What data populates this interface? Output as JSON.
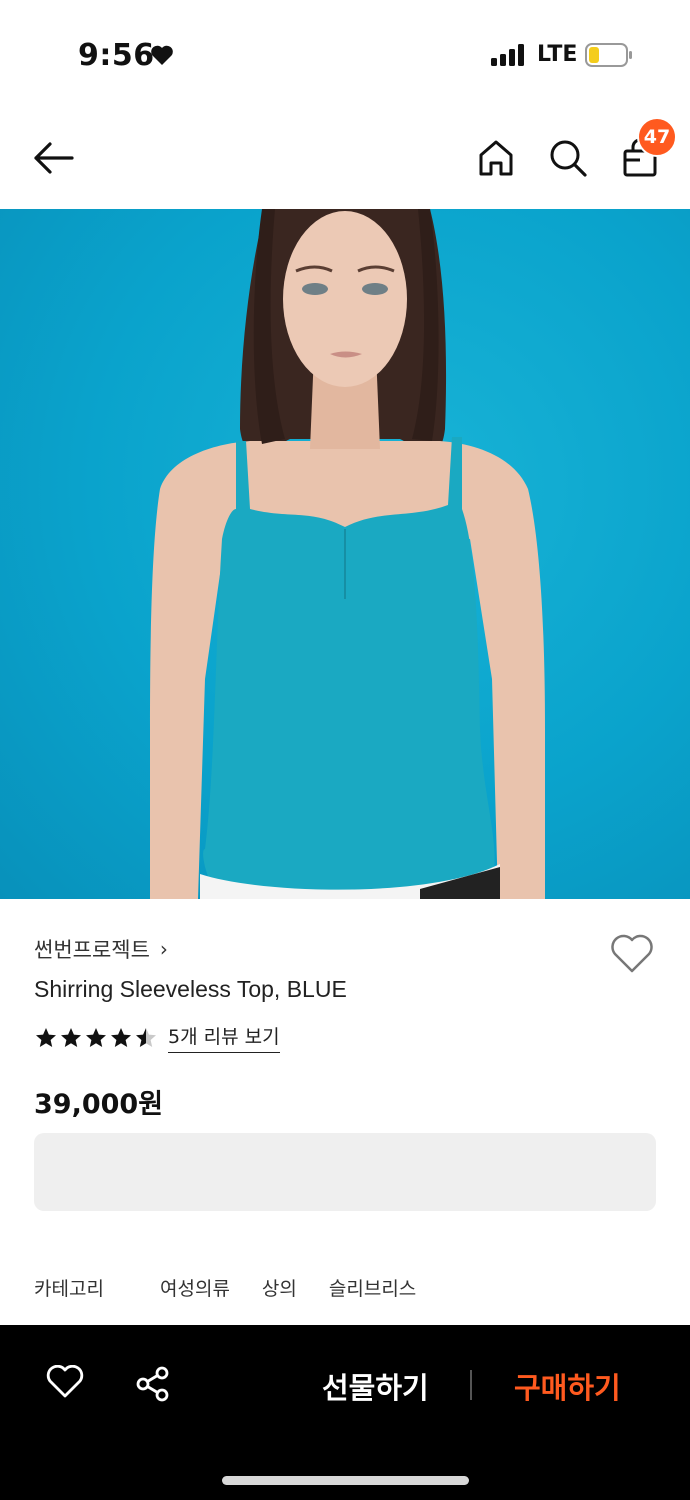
{
  "status_bar": {
    "time": "9:56",
    "network": "LTE"
  },
  "nav": {
    "cart_count": "47"
  },
  "product": {
    "brand": "썬번프로젝트",
    "brand_chevron": "›",
    "title": "Shirring Sleeveless Top, BLUE",
    "rating": 4.5,
    "review_link": "5개 리뷰 보기",
    "price": "39,000원"
  },
  "category": {
    "label": "카테고리",
    "items": [
      "여성의류",
      "상의",
      "슬리브리스"
    ]
  },
  "bottom_bar": {
    "gift_label": "선물하기",
    "buy_label": "구매하기"
  },
  "colors": {
    "accent": "#ff5a1f",
    "hero_bg": "#0aa3cc",
    "top_color": "#1aa9c2"
  }
}
